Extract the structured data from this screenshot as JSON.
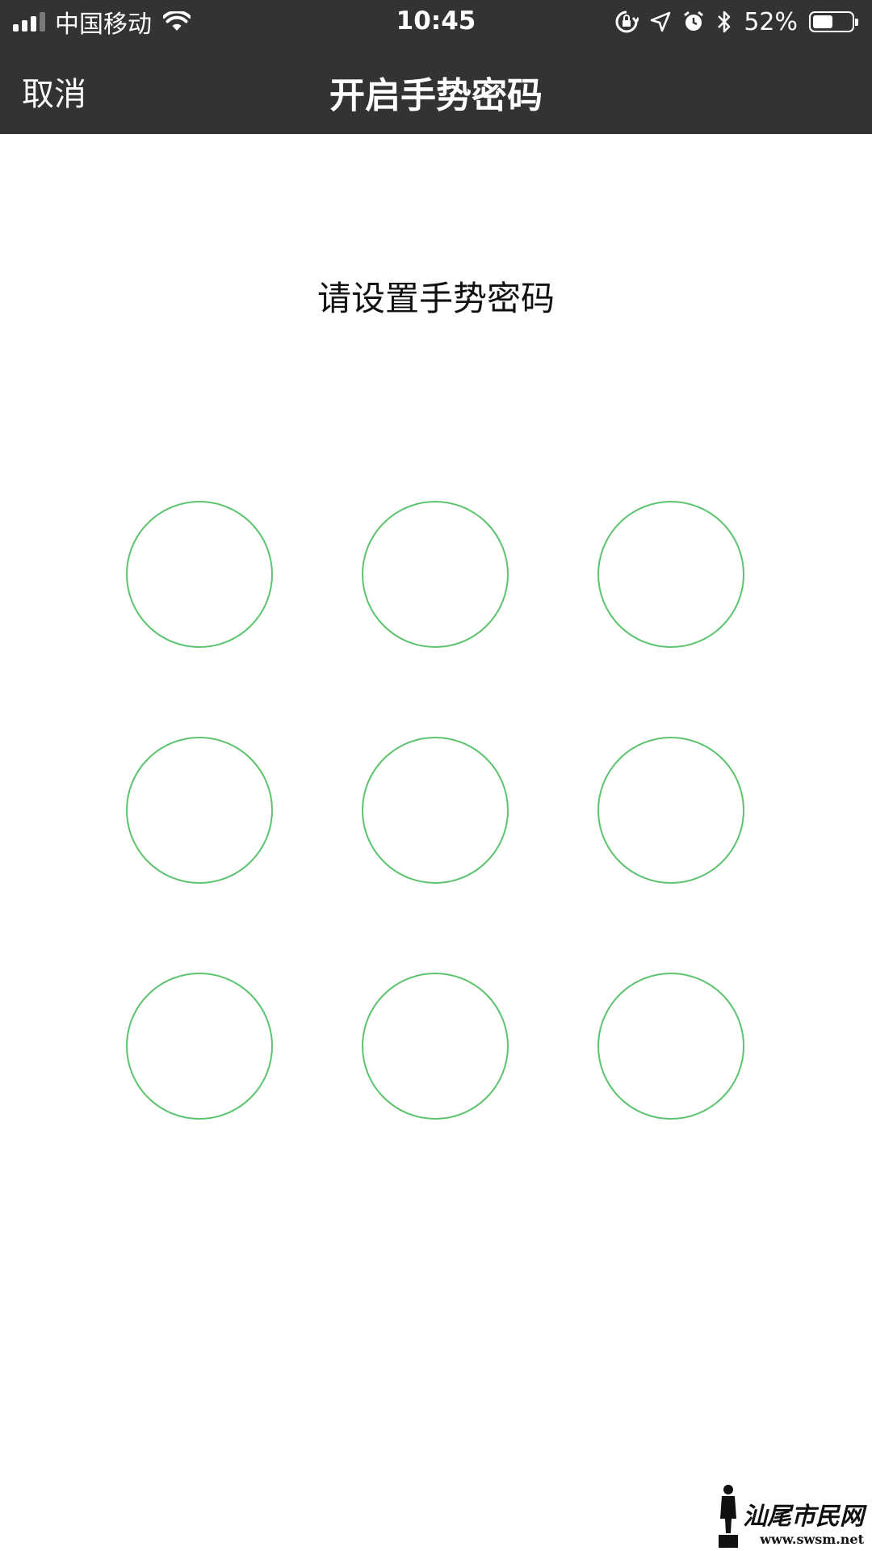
{
  "status_bar": {
    "carrier": "中国移动",
    "time": "10:45",
    "battery_percent": "52%",
    "battery_level": 0.52,
    "signal_bars_filled": 3,
    "signal_bars_total": 4,
    "icons": [
      "signal-icon",
      "wifi-icon",
      "orientation-lock-icon",
      "location-icon",
      "alarm-icon",
      "bluetooth-icon",
      "battery-icon"
    ]
  },
  "nav": {
    "cancel_label": "取消",
    "title": "开启手势密码"
  },
  "prompt": "请设置手势密码",
  "pattern": {
    "rows": 3,
    "cols": 3,
    "node_color": "#5cc36e",
    "selected_nodes": []
  },
  "watermark": {
    "name": "汕尾市民网",
    "url": "www.swsm.net"
  },
  "colors": {
    "header_bg": "#333336",
    "page_bg": "#ffffff",
    "accent": "#5cc36e"
  }
}
